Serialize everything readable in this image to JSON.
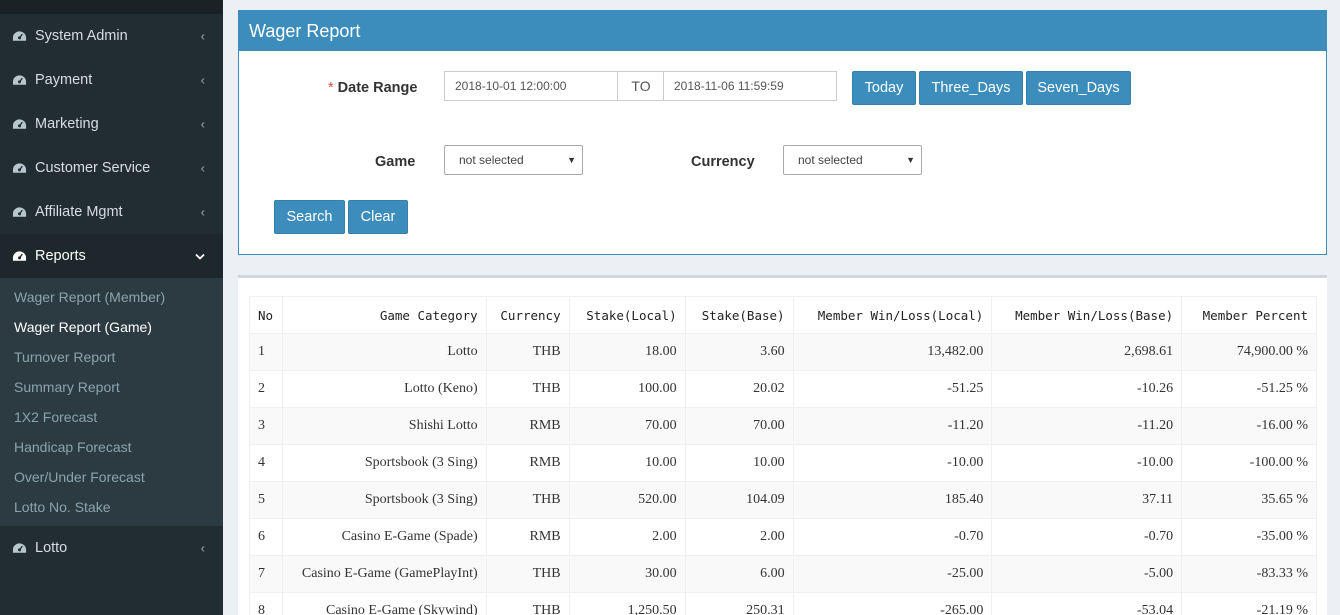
{
  "sidebar": {
    "menu": [
      {
        "label": "System Admin",
        "icon": "dashboard-icon"
      },
      {
        "label": "Payment",
        "icon": "dashboard-icon"
      },
      {
        "label": "Marketing",
        "icon": "dashboard-icon"
      },
      {
        "label": "Customer Service",
        "icon": "dashboard-icon"
      },
      {
        "label": "Affiliate Mgmt",
        "icon": "dashboard-icon"
      },
      {
        "label": "Reports",
        "icon": "dashboard-icon"
      },
      {
        "label": "Lotto",
        "icon": "dashboard-icon"
      }
    ],
    "reports_submenu": [
      "Wager Report (Member)",
      "Wager Report (Game)",
      "Turnover Report",
      "Summary Report",
      "1X2 Forecast",
      "Handicap Forecast",
      "Over/Under Forecast",
      "Lotto No. Stake"
    ]
  },
  "search_box": {
    "title": "Wager Report",
    "date_range_label": "Date Range",
    "required_mark": "*",
    "date_from": "2018-10-01 12:00:00",
    "to_label": "TO",
    "date_to": "2018-11-06 11:59:59",
    "quick_buttons": [
      "Today",
      "Three_Days",
      "Seven_Days"
    ],
    "game_label": "Game",
    "game_value": "not selected",
    "currency_label": "Currency",
    "currency_value": "not selected",
    "search_label": "Search",
    "clear_label": "Clear"
  },
  "table": {
    "headers": [
      "No",
      "Game Category",
      "Currency",
      "Stake(Local)",
      "Stake(Base)",
      "Member Win/Loss(Local)",
      "Member Win/Loss(Base)",
      "Member Percent"
    ],
    "rows": [
      [
        "1",
        "Lotto",
        "THB",
        "18.00",
        "3.60",
        "13,482.00",
        "2,698.61",
        "74,900.00 %"
      ],
      [
        "2",
        "Lotto (Keno)",
        "THB",
        "100.00",
        "20.02",
        "-51.25",
        "-10.26",
        "-51.25 %"
      ],
      [
        "3",
        "Shishi Lotto",
        "RMB",
        "70.00",
        "70.00",
        "-11.20",
        "-11.20",
        "-16.00 %"
      ],
      [
        "4",
        "Sportsbook (3 Sing)",
        "RMB",
        "10.00",
        "10.00",
        "-10.00",
        "-10.00",
        "-100.00 %"
      ],
      [
        "5",
        "Sportsbook (3 Sing)",
        "THB",
        "520.00",
        "104.09",
        "185.40",
        "37.11",
        "35.65 %"
      ],
      [
        "6",
        "Casino E-Game (Spade)",
        "RMB",
        "2.00",
        "2.00",
        "-0.70",
        "-0.70",
        "-35.00 %"
      ],
      [
        "7",
        "Casino E-Game (GamePlayInt)",
        "THB",
        "30.00",
        "6.00",
        "-25.00",
        "-5.00",
        "-83.33 %"
      ],
      [
        "8",
        "Casino E-Game (Skywind)",
        "THB",
        "1,250.50",
        "250.31",
        "-265.00",
        "-53.04",
        "-21.19 %"
      ]
    ]
  }
}
